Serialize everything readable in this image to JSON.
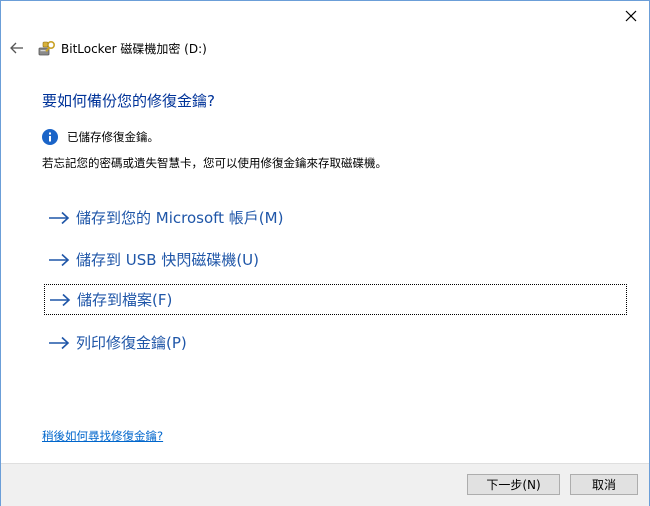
{
  "window": {
    "title": "BitLocker 磁碟機加密 (D:)",
    "accent_color": "#003399",
    "link_color": "#1f56a8"
  },
  "main": {
    "heading": "要如何備份您的修復金鑰?",
    "info_text": "已儲存修復金鑰。",
    "description": "若忘記您的密碼或遺失智慧卡，您可以使用修復金鑰來存取磁碟機。",
    "options": [
      {
        "label": "儲存到您的 Microsoft 帳戶(M)",
        "focused": false
      },
      {
        "label": "儲存到 USB 快閃磁碟機(U)",
        "focused": false
      },
      {
        "label": "儲存到檔案(F)",
        "focused": true
      },
      {
        "label": "列印修復金鑰(P)",
        "focused": false
      }
    ],
    "help_link": "稍後如何尋找修復金鑰?"
  },
  "footer": {
    "next_label": "下一步(N)",
    "cancel_label": "取消"
  }
}
